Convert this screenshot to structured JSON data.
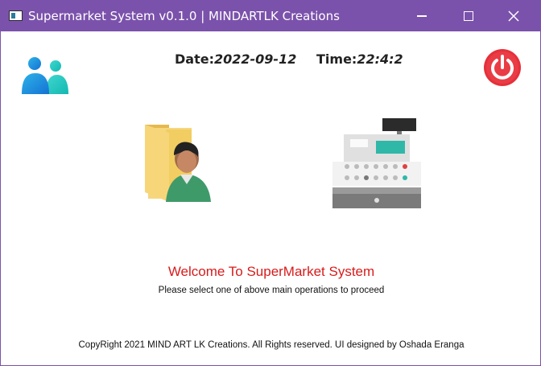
{
  "window": {
    "title": "Supermarket System v0.1.0 | MINDARTLK Creations",
    "controls": [
      "minimize-icon",
      "maximize-icon",
      "close-icon"
    ],
    "title_bar_color": "#7b52ab"
  },
  "header": {
    "date_label": "Date:",
    "date_value": "2022-09-12",
    "time_label": "Time:",
    "time_value": "22:4:2"
  },
  "icons": {
    "users": "users-icon",
    "power": "power-icon",
    "user_management": "user-folder-icon",
    "cashier": "cash-register-icon"
  },
  "main": {
    "welcome": "Welcome To SuperMarket System",
    "instruction": "Please select one of above main operations to proceed"
  },
  "footer": {
    "copyright": "CopyRight 2021 MIND ART LK Creations. All Rights reserved. UI designed by Oshada Eranga"
  },
  "colors": {
    "accent": "#7b52ab",
    "welcome": "#d81b1b",
    "power": "#e5303a"
  }
}
